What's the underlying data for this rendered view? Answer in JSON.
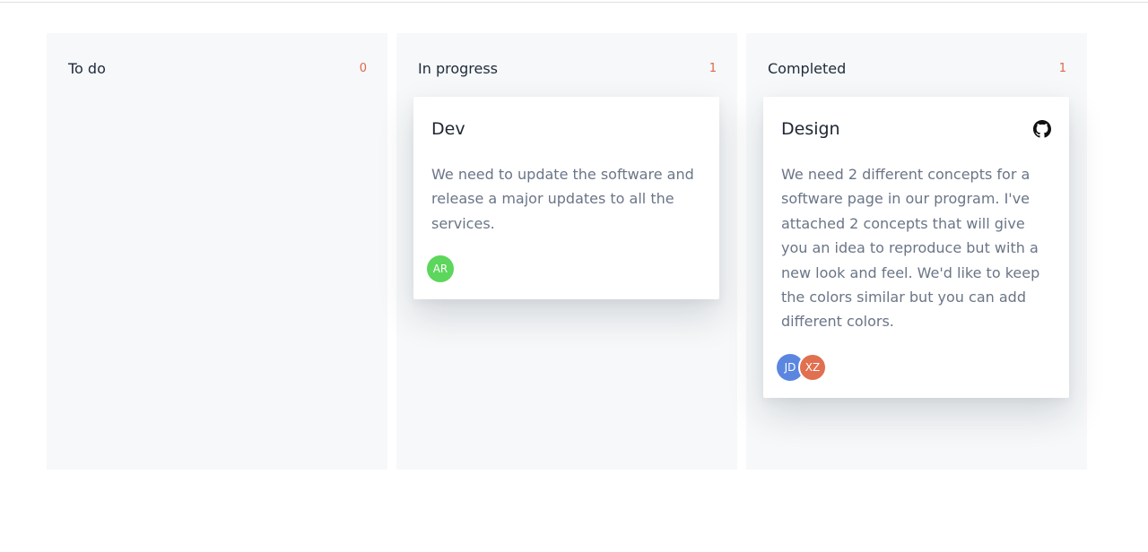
{
  "board": {
    "columns": [
      {
        "title": "To do",
        "count": "0",
        "cards": []
      },
      {
        "title": "In progress",
        "count": "1",
        "cards": [
          {
            "title": "Dev",
            "description": "We need to update the software and release a major updates to all the services.",
            "icon": null,
            "avatars": [
              {
                "initials": "AR",
                "color": "#5cd65c"
              }
            ]
          }
        ]
      },
      {
        "title": "Completed",
        "count": "1",
        "cards": [
          {
            "title": "Design",
            "description": "We need 2 different concepts for a software page in our program. I've attached 2 concepts that will give you an idea to reproduce but with a new look and feel. We'd like to keep the colors similar but you can add different colors.",
            "icon": "github-icon",
            "avatars": [
              {
                "initials": "JD",
                "color": "#5b86e0"
              },
              {
                "initials": "XZ",
                "color": "#e0704f"
              }
            ]
          }
        ]
      }
    ]
  },
  "colors": {
    "column_bg": "#f6f8f9",
    "count_accent": "#e0664a",
    "title_text": "#1f2a3a",
    "description_text": "#6a7587"
  }
}
